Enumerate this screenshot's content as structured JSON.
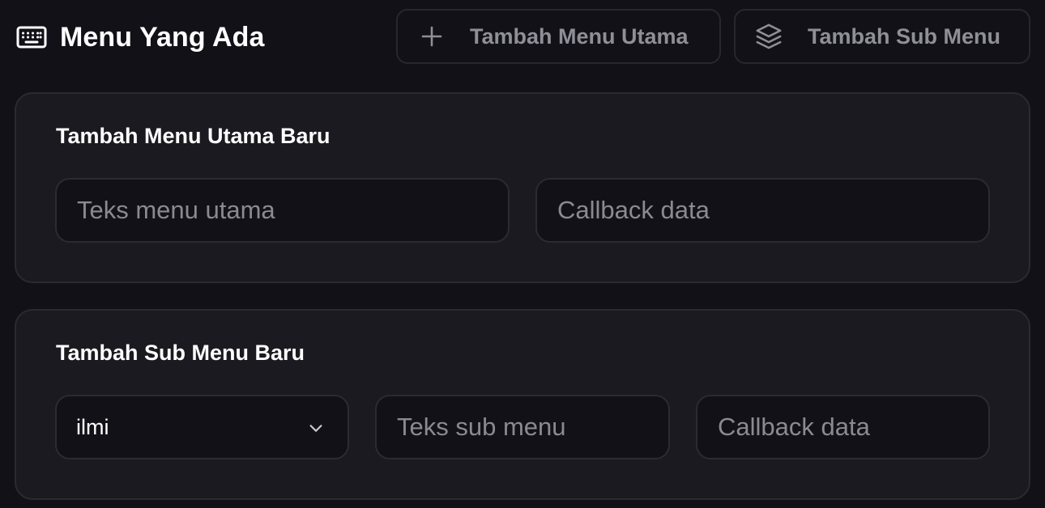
{
  "header": {
    "title": "Menu Yang Ada",
    "title_icon": "keyboard-icon",
    "buttons": [
      {
        "label": "Tambah Menu Utama",
        "icon": "plus-icon"
      },
      {
        "label": "Tambah Sub Menu",
        "icon": "layers-icon"
      }
    ]
  },
  "main_menu_form": {
    "title": "Tambah Menu Utama Baru",
    "text_placeholder": "Teks menu utama",
    "callback_placeholder": "Callback data"
  },
  "sub_menu_form": {
    "title": "Tambah Sub Menu Baru",
    "parent_select_value": "ilmi",
    "parent_select_icon": "chevron-down-icon",
    "text_placeholder": "Teks sub menu",
    "callback_placeholder": "Callback data"
  },
  "colors": {
    "background": "#121117",
    "card_background": "#1b1a20",
    "border": "#2b2b31",
    "muted_text": "#8f8f97"
  }
}
